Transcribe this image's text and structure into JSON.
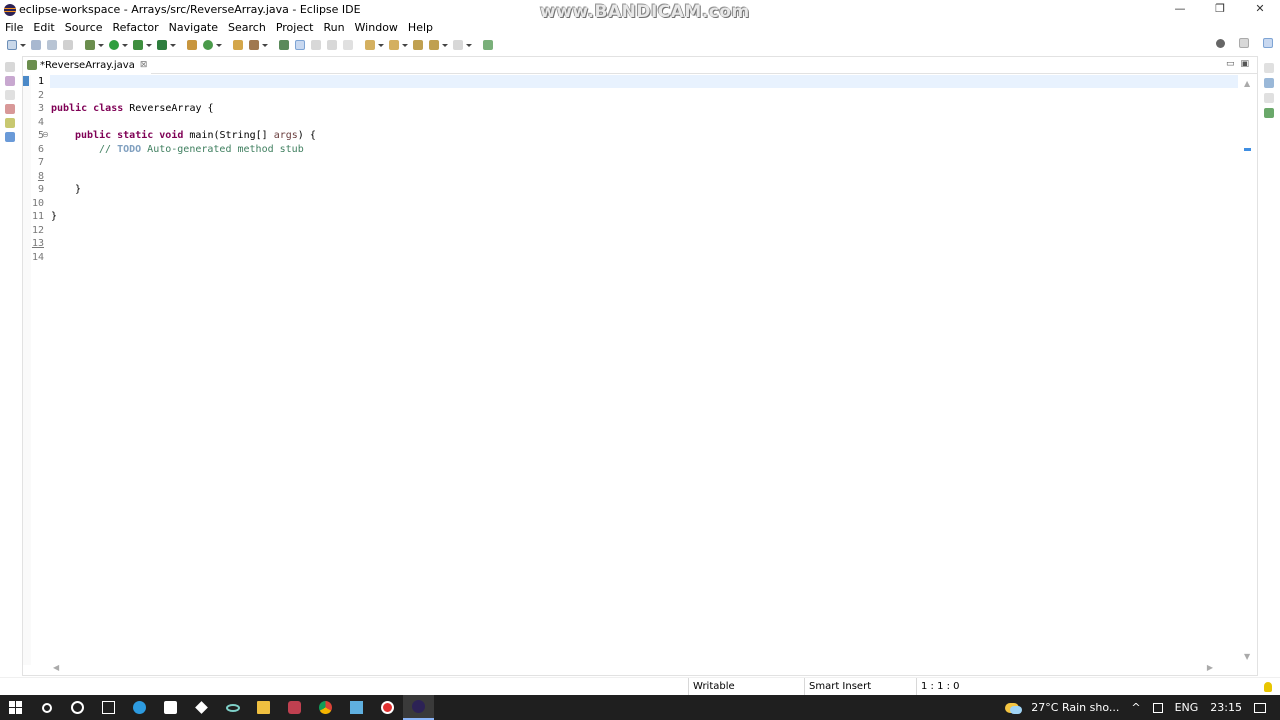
{
  "window": {
    "title": "eclipse-workspace - Arrays/src/ReverseArray.java - Eclipse IDE",
    "watermark": "www.BANDICAM.com",
    "controls": {
      "minimize": "—",
      "maximize": "❐",
      "close": "✕"
    }
  },
  "menu": [
    "File",
    "Edit",
    "Source",
    "Refactor",
    "Navigate",
    "Search",
    "Project",
    "Run",
    "Window",
    "Help"
  ],
  "editor": {
    "tab": {
      "label": "*ReverseArray.java",
      "close_glyph": "⊠"
    },
    "view_controls": {
      "minimize": "▭",
      "maximize": "▣"
    },
    "line_numbers": [
      "1",
      "2",
      "3",
      "4",
      "5",
      "6",
      "7",
      "8",
      "9",
      "10",
      "11",
      "12",
      "13",
      "14"
    ],
    "code": {
      "l3_kw": "public class",
      "l3_rest": " ReverseArray {",
      "l5_kw": "public static void",
      "l5_rest": " main(String[] ",
      "l5_param": "args",
      "l5_end": ") {",
      "l6_prefix": "// ",
      "l6_todo": "TODO",
      "l6_rest": " Auto-generated method stub",
      "l9": "}",
      "l11": "}"
    },
    "fold_glyph": "⊖"
  },
  "status": {
    "writable": "Writable",
    "insert_mode": "Smart Insert",
    "position": "1 : 1 : 0"
  },
  "taskbar": {
    "weather": "27°C  Rain sho...",
    "language": "ENG",
    "time": "23:15",
    "chevron": "^",
    "colors": {
      "background": "#1f1f1f"
    }
  },
  "colors": {
    "keyword": "#7f0055",
    "comment": "#3f7f5f",
    "todo": "#7f9fbf",
    "current_line": "#e8f2fe"
  }
}
